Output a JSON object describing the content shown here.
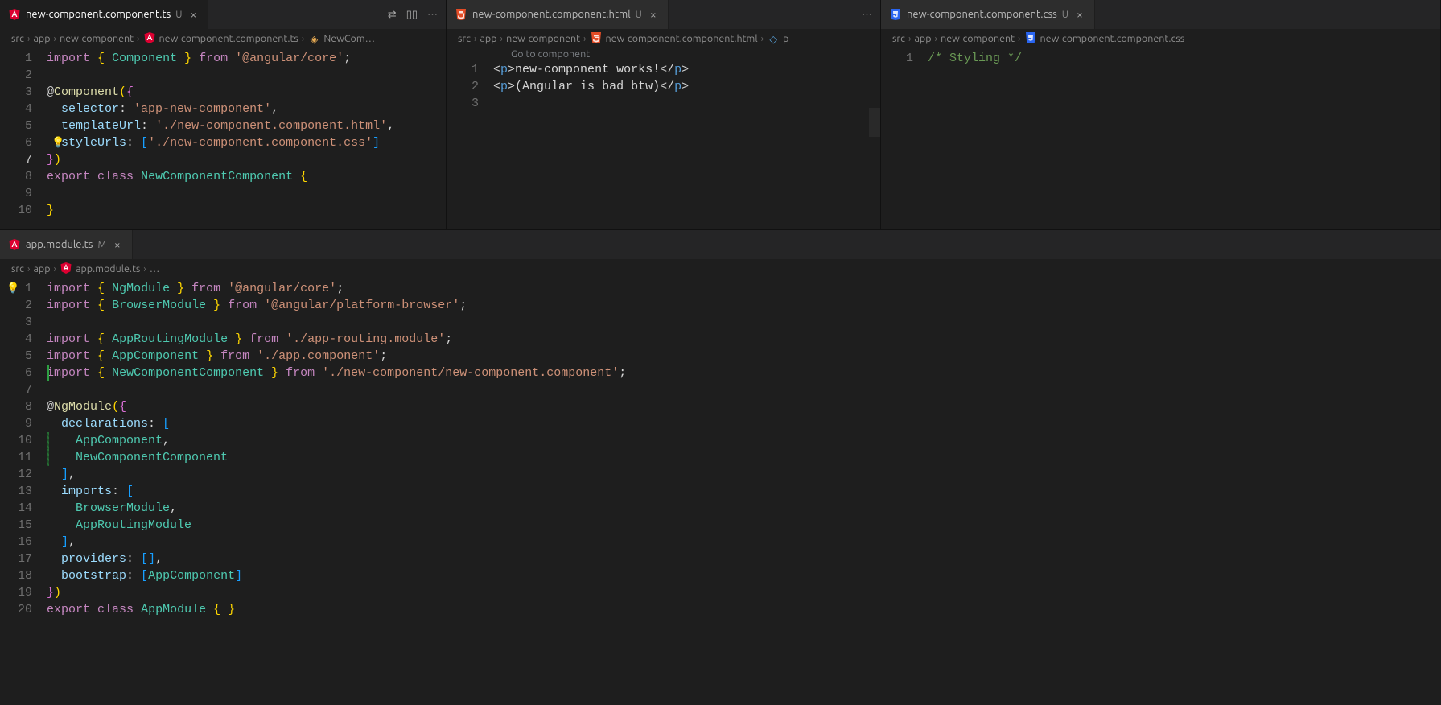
{
  "panes": {
    "topLeft": {
      "tab": {
        "icon": "angular-ts",
        "name": "new-component.component.ts",
        "badge": "U",
        "active": true
      },
      "actions": [
        "compare-icon",
        "split-icon",
        "more-icon"
      ],
      "crumbs": [
        "src",
        "app",
        "new-component",
        "new-component.component.ts",
        "NewCom…"
      ],
      "crumbIcons": {
        "3": "angular-ts",
        "4": "class"
      },
      "code": [
        {
          "n": 1,
          "tokens": [
            [
              "kw",
              "import"
            ],
            [
              "pn",
              " "
            ],
            [
              "br1",
              "{"
            ],
            [
              "pn",
              " "
            ],
            [
              "ty",
              "Component"
            ],
            [
              "pn",
              " "
            ],
            [
              "br1",
              "}"
            ],
            [
              "pn",
              " "
            ],
            [
              "kw",
              "from"
            ],
            [
              "pn",
              " "
            ],
            [
              "st",
              "'@angular/core'"
            ],
            [
              "pn",
              ";"
            ]
          ]
        },
        {
          "n": 2,
          "tokens": []
        },
        {
          "n": 3,
          "tokens": [
            [
              "pn",
              "@"
            ],
            [
              "fn",
              "Component"
            ],
            [
              "br1",
              "("
            ],
            [
              "br2",
              "{"
            ]
          ]
        },
        {
          "n": 4,
          "tokens": [
            [
              "pn",
              "  "
            ],
            [
              "at",
              "selector"
            ],
            [
              "pn",
              ": "
            ],
            [
              "st",
              "'app-new-component'"
            ],
            [
              "pn",
              ","
            ]
          ]
        },
        {
          "n": 5,
          "tokens": [
            [
              "pn",
              "  "
            ],
            [
              "at",
              "templateUrl"
            ],
            [
              "pn",
              ": "
            ],
            [
              "st",
              "'./new-component.component.html'"
            ],
            [
              "pn",
              ","
            ]
          ]
        },
        {
          "n": 6,
          "tokens": [
            [
              "pn",
              "  "
            ],
            [
              "at",
              "styleUrls"
            ],
            [
              "pn",
              ": "
            ],
            [
              "br3",
              "["
            ],
            [
              "st",
              "'./new-component.component.css'"
            ],
            [
              "br3",
              "]"
            ]
          ],
          "bulb": true
        },
        {
          "n": 7,
          "tokens": [
            [
              "br2",
              "}"
            ],
            [
              "br1",
              ")"
            ]
          ],
          "current": true
        },
        {
          "n": 8,
          "tokens": [
            [
              "kw",
              "export"
            ],
            [
              "pn",
              " "
            ],
            [
              "kw",
              "class"
            ],
            [
              "pn",
              " "
            ],
            [
              "ty",
              "NewComponentComponent"
            ],
            [
              "pn",
              " "
            ],
            [
              "br1",
              "{"
            ]
          ]
        },
        {
          "n": 9,
          "tokens": []
        },
        {
          "n": 10,
          "tokens": [
            [
              "br1",
              "}"
            ]
          ]
        }
      ]
    },
    "topMid": {
      "tab": {
        "icon": "html",
        "name": "new-component.component.html",
        "badge": "U",
        "active": false
      },
      "actions": [
        "more-icon"
      ],
      "crumbs": [
        "src",
        "app",
        "new-component",
        "new-component.component.html",
        "p"
      ],
      "crumbIcons": {
        "3": "html",
        "4": "element"
      },
      "hint": "Go to component",
      "code": [
        {
          "n": 1,
          "tokens": [
            [
              "pn",
              "<"
            ],
            [
              "tg",
              "p"
            ],
            [
              "pn",
              ">"
            ],
            [
              "pn",
              "new-component works!"
            ],
            [
              "pn",
              "</"
            ],
            [
              "tg",
              "p"
            ],
            [
              "pn",
              ">"
            ]
          ]
        },
        {
          "n": 2,
          "tokens": [
            [
              "pn",
              "<"
            ],
            [
              "tg",
              "p"
            ],
            [
              "pn",
              ">"
            ],
            [
              "pn",
              "(Angular is bad btw)"
            ],
            [
              "pn",
              "</"
            ],
            [
              "tg",
              "p"
            ],
            [
              "pn",
              ">"
            ]
          ]
        },
        {
          "n": 3,
          "tokens": []
        }
      ]
    },
    "topRight": {
      "tab": {
        "icon": "css",
        "name": "new-component.component.css",
        "badge": "U",
        "active": false
      },
      "crumbs": [
        "src",
        "app",
        "new-component",
        "new-component.component.css"
      ],
      "crumbIcons": {
        "3": "css"
      },
      "code": [
        {
          "n": 1,
          "tokens": [
            [
              "cm",
              "/* Styling */"
            ]
          ]
        }
      ]
    },
    "bottom": {
      "tab": {
        "icon": "angular",
        "name": "app.module.ts",
        "badge": "M",
        "active": false
      },
      "crumbs": [
        "src",
        "app",
        "app.module.ts",
        "…"
      ],
      "crumbIcons": {
        "2": "angular"
      },
      "bulbFar": true,
      "code": [
        {
          "n": 1,
          "tokens": [
            [
              "kw",
              "import"
            ],
            [
              "pn",
              " "
            ],
            [
              "br1",
              "{"
            ],
            [
              "pn",
              " "
            ],
            [
              "ty",
              "NgModule"
            ],
            [
              "pn",
              " "
            ],
            [
              "br1",
              "}"
            ],
            [
              "pn",
              " "
            ],
            [
              "kw",
              "from"
            ],
            [
              "pn",
              " "
            ],
            [
              "st",
              "'@angular/core'"
            ],
            [
              "pn",
              ";"
            ]
          ]
        },
        {
          "n": 2,
          "tokens": [
            [
              "kw",
              "import"
            ],
            [
              "pn",
              " "
            ],
            [
              "br1",
              "{"
            ],
            [
              "pn",
              " "
            ],
            [
              "ty",
              "BrowserModule"
            ],
            [
              "pn",
              " "
            ],
            [
              "br1",
              "}"
            ],
            [
              "pn",
              " "
            ],
            [
              "kw",
              "from"
            ],
            [
              "pn",
              " "
            ],
            [
              "st",
              "'@angular/platform-browser'"
            ],
            [
              "pn",
              ";"
            ]
          ]
        },
        {
          "n": 3,
          "tokens": []
        },
        {
          "n": 4,
          "tokens": [
            [
              "kw",
              "import"
            ],
            [
              "pn",
              " "
            ],
            [
              "br1",
              "{"
            ],
            [
              "pn",
              " "
            ],
            [
              "ty",
              "AppRoutingModule"
            ],
            [
              "pn",
              " "
            ],
            [
              "br1",
              "}"
            ],
            [
              "pn",
              " "
            ],
            [
              "kw",
              "from"
            ],
            [
              "pn",
              " "
            ],
            [
              "st",
              "'./app-routing.module'"
            ],
            [
              "pn",
              ";"
            ]
          ]
        },
        {
          "n": 5,
          "tokens": [
            [
              "kw",
              "import"
            ],
            [
              "pn",
              " "
            ],
            [
              "br1",
              "{"
            ],
            [
              "pn",
              " "
            ],
            [
              "ty",
              "AppComponent"
            ],
            [
              "pn",
              " "
            ],
            [
              "br1",
              "}"
            ],
            [
              "pn",
              " "
            ],
            [
              "kw",
              "from"
            ],
            [
              "pn",
              " "
            ],
            [
              "st",
              "'./app.component'"
            ],
            [
              "pn",
              ";"
            ]
          ]
        },
        {
          "n": 6,
          "tokens": [
            [
              "kw",
              "import"
            ],
            [
              "pn",
              " "
            ],
            [
              "br1",
              "{"
            ],
            [
              "pn",
              " "
            ],
            [
              "ty",
              "NewComponentComponent"
            ],
            [
              "pn",
              " "
            ],
            [
              "br1",
              "}"
            ],
            [
              "pn",
              " "
            ],
            [
              "kw",
              "from"
            ],
            [
              "pn",
              " "
            ],
            [
              "st",
              "'./new-component/new-component.component'"
            ],
            [
              "pn",
              ";"
            ]
          ],
          "gitmod": true
        },
        {
          "n": 7,
          "tokens": []
        },
        {
          "n": 8,
          "tokens": [
            [
              "pn",
              "@"
            ],
            [
              "fn",
              "NgModule"
            ],
            [
              "br1",
              "("
            ],
            [
              "br2",
              "{"
            ]
          ]
        },
        {
          "n": 9,
          "tokens": [
            [
              "pn",
              "  "
            ],
            [
              "at",
              "declarations"
            ],
            [
              "pn",
              ": "
            ],
            [
              "br3",
              "["
            ]
          ]
        },
        {
          "n": 10,
          "tokens": [
            [
              "pn",
              "    "
            ],
            [
              "ty",
              "AppComponent"
            ],
            [
              "pn",
              ","
            ]
          ],
          "gitadd": true
        },
        {
          "n": 11,
          "tokens": [
            [
              "pn",
              "    "
            ],
            [
              "ty",
              "NewComponentComponent"
            ]
          ],
          "gitadd": true
        },
        {
          "n": 12,
          "tokens": [
            [
              "pn",
              "  "
            ],
            [
              "br3",
              "]"
            ],
            [
              "pn",
              ","
            ]
          ]
        },
        {
          "n": 13,
          "tokens": [
            [
              "pn",
              "  "
            ],
            [
              "at",
              "imports"
            ],
            [
              "pn",
              ": "
            ],
            [
              "br3",
              "["
            ]
          ]
        },
        {
          "n": 14,
          "tokens": [
            [
              "pn",
              "    "
            ],
            [
              "ty",
              "BrowserModule"
            ],
            [
              "pn",
              ","
            ]
          ]
        },
        {
          "n": 15,
          "tokens": [
            [
              "pn",
              "    "
            ],
            [
              "ty",
              "AppRoutingModule"
            ]
          ]
        },
        {
          "n": 16,
          "tokens": [
            [
              "pn",
              "  "
            ],
            [
              "br3",
              "]"
            ],
            [
              "pn",
              ","
            ]
          ]
        },
        {
          "n": 17,
          "tokens": [
            [
              "pn",
              "  "
            ],
            [
              "at",
              "providers"
            ],
            [
              "pn",
              ": "
            ],
            [
              "br3",
              "["
            ],
            [
              "br3",
              "]"
            ],
            [
              "pn",
              ","
            ]
          ]
        },
        {
          "n": 18,
          "tokens": [
            [
              "pn",
              "  "
            ],
            [
              "at",
              "bootstrap"
            ],
            [
              "pn",
              ": "
            ],
            [
              "br3",
              "["
            ],
            [
              "ty",
              "AppComponent"
            ],
            [
              "br3",
              "]"
            ]
          ]
        },
        {
          "n": 19,
          "tokens": [
            [
              "br2",
              "}"
            ],
            [
              "br1",
              ")"
            ]
          ]
        },
        {
          "n": 20,
          "tokens": [
            [
              "kw",
              "export"
            ],
            [
              "pn",
              " "
            ],
            [
              "kw",
              "class"
            ],
            [
              "pn",
              " "
            ],
            [
              "ty",
              "AppModule"
            ],
            [
              "pn",
              " "
            ],
            [
              "br1",
              "{"
            ],
            [
              "pn",
              " "
            ],
            [
              "br1",
              "}"
            ]
          ]
        }
      ]
    }
  },
  "icons": {
    "compare": "⇄",
    "split": "▯▯",
    "more": "⋯"
  }
}
